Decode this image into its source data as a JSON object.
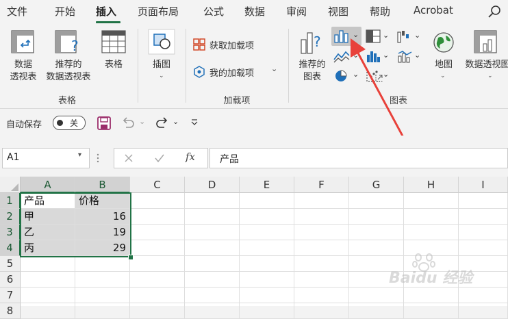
{
  "tabs": [
    "文件",
    "开始",
    "插入",
    "页面布局",
    "公式",
    "数据",
    "审阅",
    "视图",
    "帮助",
    "Acrobat"
  ],
  "active_tab": "插入",
  "ribbon": {
    "tables": {
      "pivot_label1": "数据",
      "pivot_label2": "透视表",
      "rec_pivot_label1": "推荐的",
      "rec_pivot_label2": "数据透视表",
      "table_label": "表格",
      "group_label": "表格"
    },
    "illustrations": {
      "label": "插图"
    },
    "addins": {
      "get_label": "获取加载项",
      "my_label": "我的加载项",
      "group_label": "加载项"
    },
    "charts": {
      "rec_label1": "推荐的",
      "rec_label2": "图表",
      "map_label": "地图",
      "pivot_chart_label": "数据透视图",
      "group_label": "图表"
    }
  },
  "qat": {
    "autosave_label": "自动保存",
    "autosave_state": "关"
  },
  "formula_bar": {
    "name_box": "A1",
    "fx": "fx",
    "content": "产品"
  },
  "columns": [
    "A",
    "B",
    "C",
    "D",
    "E",
    "F",
    "G",
    "H",
    "I"
  ],
  "rows": [
    "1",
    "2",
    "3",
    "4",
    "5",
    "6",
    "7",
    "8"
  ],
  "cells": {
    "a1": "产品",
    "b1": "价格",
    "a2": "甲",
    "b2": "16",
    "a3": "乙",
    "b3": "19",
    "a4": "丙",
    "b4": "29"
  },
  "watermark": "Baidu 经验",
  "colors": {
    "accent": "#217346",
    "arrow": "#e8413a"
  }
}
